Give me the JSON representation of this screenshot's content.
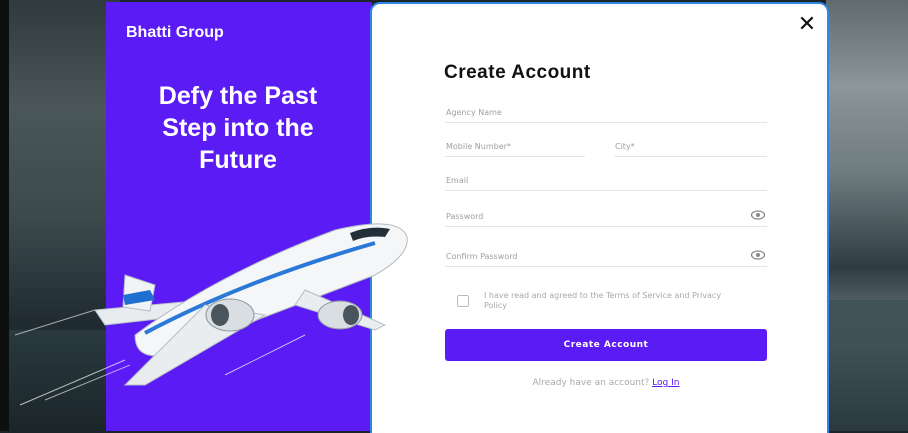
{
  "brand": "Bhatti Group",
  "tagline": [
    "Defy the Past",
    "Step into the",
    "Future"
  ],
  "form": {
    "title": "Create Account",
    "agency_name_placeholder": "Agency Name",
    "mobile_placeholder": "Mobile Number*",
    "city_placeholder": "City*",
    "email_placeholder": "Email",
    "password_placeholder": "Password",
    "confirm_password_placeholder": "Confirm Password",
    "terms_text": "I have read and agreed to the Terms of Service and Privacy Policy",
    "submit_label": "Create Account",
    "login_prompt": "Already have an account?",
    "login_link": "Log In"
  },
  "close_icon": "close-icon",
  "colors": {
    "accent": "#5b1bf5",
    "border": "#2f87e3"
  }
}
